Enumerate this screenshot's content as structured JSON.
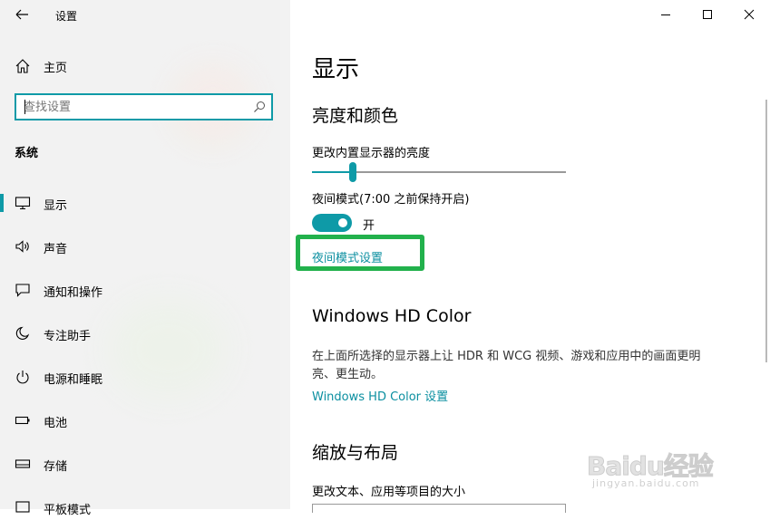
{
  "window": {
    "title": "设置"
  },
  "sidebar": {
    "home_label": "主页",
    "search_placeholder": "查找设置",
    "section_title": "系统",
    "items": [
      {
        "label": "显示",
        "icon": "monitor-icon",
        "active": true
      },
      {
        "label": "声音",
        "icon": "speaker-icon"
      },
      {
        "label": "通知和操作",
        "icon": "notification-icon"
      },
      {
        "label": "专注助手",
        "icon": "moon-icon"
      },
      {
        "label": "电源和睡眠",
        "icon": "power-icon"
      },
      {
        "label": "电池",
        "icon": "battery-icon"
      },
      {
        "label": "存储",
        "icon": "storage-icon"
      },
      {
        "label": "平板模式",
        "icon": "tablet-icon"
      }
    ]
  },
  "content": {
    "page_title": "显示",
    "brightness": {
      "heading": "亮度和颜色",
      "slider_label": "更改内置显示器的亮度",
      "value": 16
    },
    "night_light": {
      "label": "夜间模式(7:00 之前保持开启)",
      "toggle_state": "开",
      "settings_link": "夜间模式设置"
    },
    "hd_color": {
      "heading": "Windows HD Color",
      "description": "在上面所选择的显示器上让 HDR 和 WCG 视频、游戏和应用中的画面更明亮、更生动。",
      "link": "Windows HD Color 设置"
    },
    "scale": {
      "heading": "缩放与布局",
      "label": "更改文本、应用等项目的大小"
    }
  },
  "watermark": {
    "text": "Baidu经验",
    "url": "jingyan.baidu.com"
  },
  "colors": {
    "accent": "#0e9aa7",
    "highlight": "#22b14c"
  }
}
